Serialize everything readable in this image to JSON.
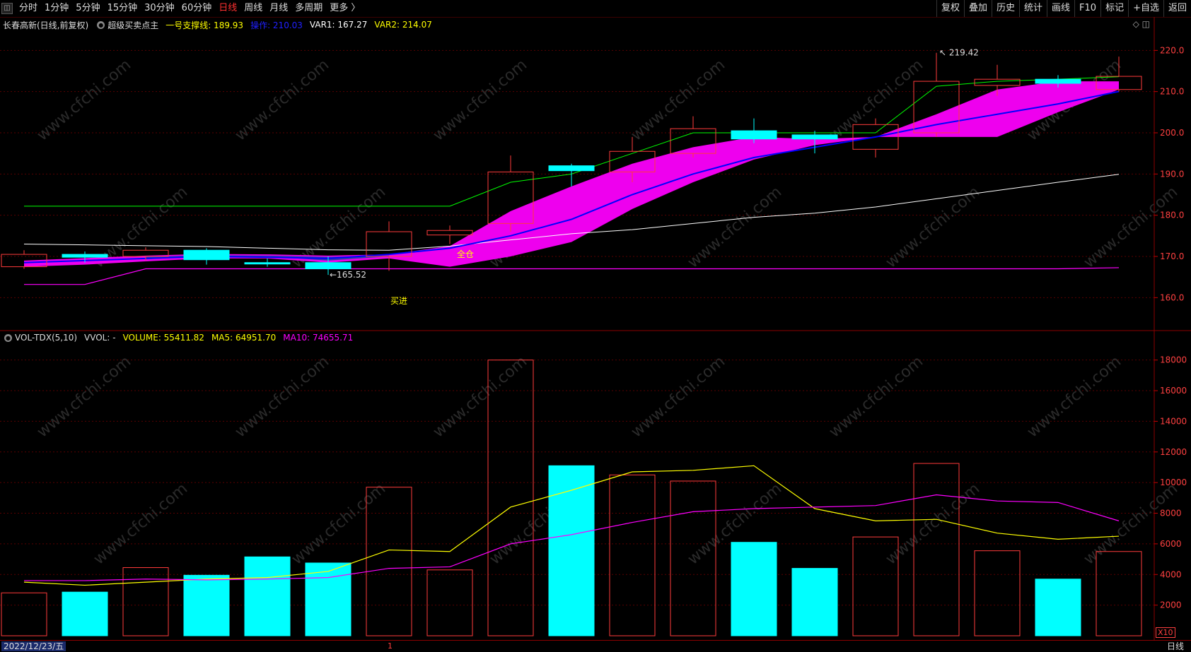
{
  "toolbar": {
    "periods": [
      "分时",
      "1分钟",
      "5分钟",
      "15分钟",
      "30分钟",
      "60分钟",
      "日线",
      "周线",
      "月线",
      "多周期",
      "更多 〉"
    ],
    "active_period": "日线",
    "right_items": [
      "复权",
      "叠加",
      "历史",
      "统计",
      "画线",
      "F10",
      "标记",
      "+自选",
      "返回"
    ]
  },
  "main": {
    "stock": "长春高新(日线,前复权)",
    "indicator": "超级买卖点主",
    "support_label": "一号支撑线: 189.93",
    "op_label": "操作: 210.03",
    "var1": "VAR1: 167.27",
    "var2": "VAR2: 214.07",
    "high_label": "219.42",
    "low_label": "165.52",
    "buy_label": "买进",
    "full_label": "全仓",
    "yticks": [
      "160.0",
      "170.0",
      "180.0",
      "190.0",
      "200.0",
      "210.0",
      "220.0"
    ],
    "yvals": [
      160,
      170,
      180,
      190,
      200,
      210,
      220
    ]
  },
  "vol": {
    "name": "VOL-TDX(5,10)",
    "vvol": "VVOL: -",
    "volume": "VOLUME: 55411.82",
    "ma5": "MA5: 64951.70",
    "ma10": "MA10: 74655.71",
    "yticks": [
      "2000",
      "4000",
      "6000",
      "8000",
      "10000",
      "12000",
      "14000",
      "16000",
      "18000"
    ],
    "yvals": [
      2000,
      4000,
      6000,
      8000,
      10000,
      12000,
      14000,
      16000,
      18000
    ],
    "x10": "X10"
  },
  "bottom": {
    "date": "2022/12/23/五",
    "tick": "1",
    "period": "日线"
  },
  "colors": {
    "up": "#ff3b3b",
    "down": "#00ffff",
    "ma5": "#ffff00",
    "ma10": "#ff00ff",
    "green": "#00ff00",
    "white": "#ffffff",
    "blue": "#0000ff"
  },
  "chart_data": {
    "type": "candlestick",
    "candles": [
      {
        "o": 167.5,
        "c": 170.5,
        "h": 171.5,
        "l": 167.0,
        "vol": 2800
      },
      {
        "o": 170.5,
        "c": 169.8,
        "h": 171.2,
        "l": 168.5,
        "vol": 2850
      },
      {
        "o": 170.0,
        "c": 171.5,
        "h": 172.2,
        "l": 169.0,
        "vol": 4450
      },
      {
        "o": 171.5,
        "c": 169.2,
        "h": 172.0,
        "l": 168.0,
        "vol": 3950
      },
      {
        "o": 168.5,
        "c": 168.2,
        "h": 169.5,
        "l": 167.5,
        "vol": 5150
      },
      {
        "o": 168.5,
        "c": 167.0,
        "h": 170.0,
        "l": 165.52,
        "vol": 4750
      },
      {
        "o": 170.0,
        "c": 176.0,
        "h": 178.5,
        "l": 166.5,
        "vol": 9700
      },
      {
        "o": 175.2,
        "c": 176.3,
        "h": 177.5,
        "l": 173.0,
        "vol": 4300
      },
      {
        "o": 178.0,
        "c": 190.5,
        "h": 194.5,
        "l": 176.0,
        "vol": 18000
      },
      {
        "o": 192.0,
        "c": 190.8,
        "h": 192.5,
        "l": 187.0,
        "vol": 11100
      },
      {
        "o": 190.5,
        "c": 195.5,
        "h": 199.0,
        "l": 188.0,
        "vol": 10500
      },
      {
        "o": 195.0,
        "c": 201.0,
        "h": 204.0,
        "l": 194.0,
        "vol": 10100
      },
      {
        "o": 200.5,
        "c": 198.5,
        "h": 203.5,
        "l": 197.5,
        "vol": 6100
      },
      {
        "o": 199.5,
        "c": 198.5,
        "h": 200.5,
        "l": 195.0,
        "vol": 4400
      },
      {
        "o": 196.0,
        "c": 202.0,
        "h": 203.5,
        "l": 194.0,
        "vol": 6450
      },
      {
        "o": 200.0,
        "c": 212.5,
        "h": 219.42,
        "l": 199.0,
        "vol": 11250
      },
      {
        "o": 211.5,
        "c": 213.0,
        "h": 216.5,
        "l": 209.0,
        "vol": 5550
      },
      {
        "o": 213.0,
        "c": 212.0,
        "h": 214.0,
        "l": 211.0,
        "vol": 3700
      },
      {
        "o": 210.5,
        "c": 213.7,
        "h": 218.5,
        "l": 210.0,
        "vol": 5500
      }
    ],
    "green_line": [
      182.2,
      182.2,
      182.2,
      182.2,
      182.2,
      182.2,
      182.2,
      182.2,
      188.0,
      190.0,
      195.0,
      200.0,
      200.0,
      200.0,
      200.0,
      211.3,
      212.5,
      213.0,
      213.6
    ],
    "white_line": [
      173.0,
      172.8,
      172.6,
      172.4,
      172.0,
      171.6,
      171.5,
      172.5,
      174.0,
      175.5,
      176.5,
      178.0,
      179.5,
      180.5,
      182.0,
      184.0,
      186.0,
      188.0,
      189.93
    ],
    "magenta_line": [
      163.2,
      163.2,
      167.0,
      167.0,
      167.0,
      167.0,
      167.0,
      167.0,
      167.0,
      167.0,
      167.0,
      167.0,
      167.0,
      167.0,
      167.0,
      167.0,
      167.0,
      167.0,
      167.27
    ],
    "blue_line": [
      168.5,
      169.0,
      169.5,
      170.0,
      169.8,
      169.5,
      170.5,
      172.0,
      175.0,
      179.0,
      185.0,
      190.0,
      194.0,
      196.5,
      199.0,
      202.0,
      204.5,
      207.0,
      210.03
    ],
    "band_upper": [
      169.0,
      169.6,
      170.2,
      170.6,
      170.5,
      170.2,
      170.5,
      172.5,
      181.0,
      187.0,
      192.5,
      196.5,
      199.0,
      198.5,
      199.0,
      204.5,
      210.5,
      212.5,
      212.5
    ],
    "band_lower": [
      167.5,
      168.0,
      168.8,
      169.5,
      169.5,
      168.5,
      169.5,
      167.5,
      170.0,
      173.5,
      181.5,
      188.0,
      193.5,
      197.0,
      199.0,
      199.0,
      199.0,
      205.0,
      210.5
    ],
    "vol_ma5": [
      3500,
      3300,
      3500,
      3700,
      3800,
      4200,
      5600,
      5500,
      8400,
      9500,
      10700,
      10800,
      11100,
      8300,
      7500,
      7600,
      6700,
      6300,
      6500
    ],
    "vol_ma10": [
      3600,
      3600,
      3700,
      3650,
      3700,
      3800,
      4400,
      4500,
      6000,
      6600,
      7400,
      8100,
      8300,
      8400,
      8500,
      9200,
      8800,
      8700,
      7500
    ]
  }
}
